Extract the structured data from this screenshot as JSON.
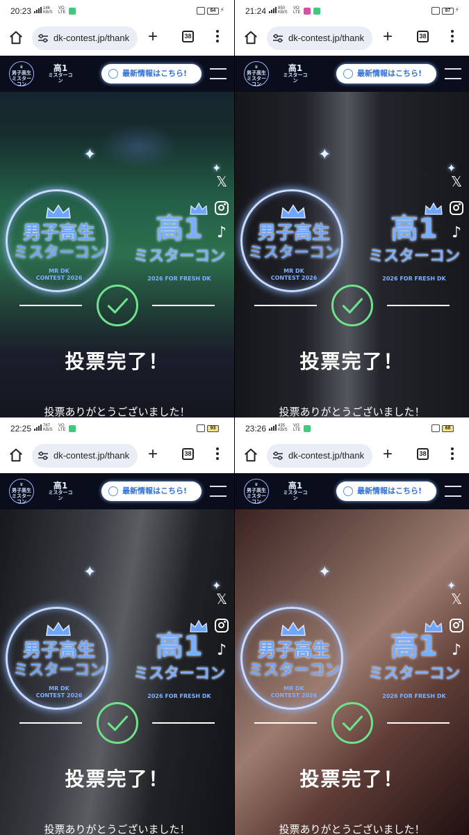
{
  "panels": [
    {
      "time": "20:23",
      "net_speed": "146",
      "net_unit": "KB/S",
      "battery": "64",
      "battery_low": false,
      "notif_color": "#43c97d"
    },
    {
      "time": "21:24",
      "net_speed": "850",
      "net_unit": "KB/S",
      "battery": "87",
      "battery_low": false,
      "notif_color": "#d94fa8"
    },
    {
      "time": "22:25",
      "net_speed": "767",
      "net_unit": "KB/S",
      "battery": "93",
      "battery_low": true,
      "notif_color": "#43c97d"
    },
    {
      "time": "23:26",
      "net_speed": "435",
      "net_unit": "KB/S",
      "battery": "68",
      "battery_low": true,
      "notif_color": "#43c97d"
    }
  ],
  "status": {
    "volte_line1": "VO",
    "volte_line2": "LTE"
  },
  "browser": {
    "url": "dk-contest.jp/thank",
    "tab_count": "38",
    "new_tab": "+"
  },
  "site": {
    "mini_logo_line1": "男子高生",
    "mini_logo_line2": "ミスターコン",
    "mini_logo2_kanji": "高1",
    "mini_logo2_sub": "ミスターコン",
    "news_button": "最新情報はこちら!"
  },
  "logo_left": {
    "line1": "男子高生",
    "line2": "ミスターコン",
    "line3": "MR DK",
    "line4": "CONTEST 2026"
  },
  "logo_right": {
    "kanji": "高1",
    "line2": "ミスターコン",
    "line3": "2026 FOR FRESH DK"
  },
  "social": {
    "x": "𝕏",
    "tiktok": "♪"
  },
  "vote": {
    "title": "投票完了！",
    "thanks": "投票ありがとうございました！"
  },
  "colors": {
    "accent_blue": "#6ea6ff",
    "check_green": "#6fe28c",
    "header_bg": "#0a0d1b"
  }
}
